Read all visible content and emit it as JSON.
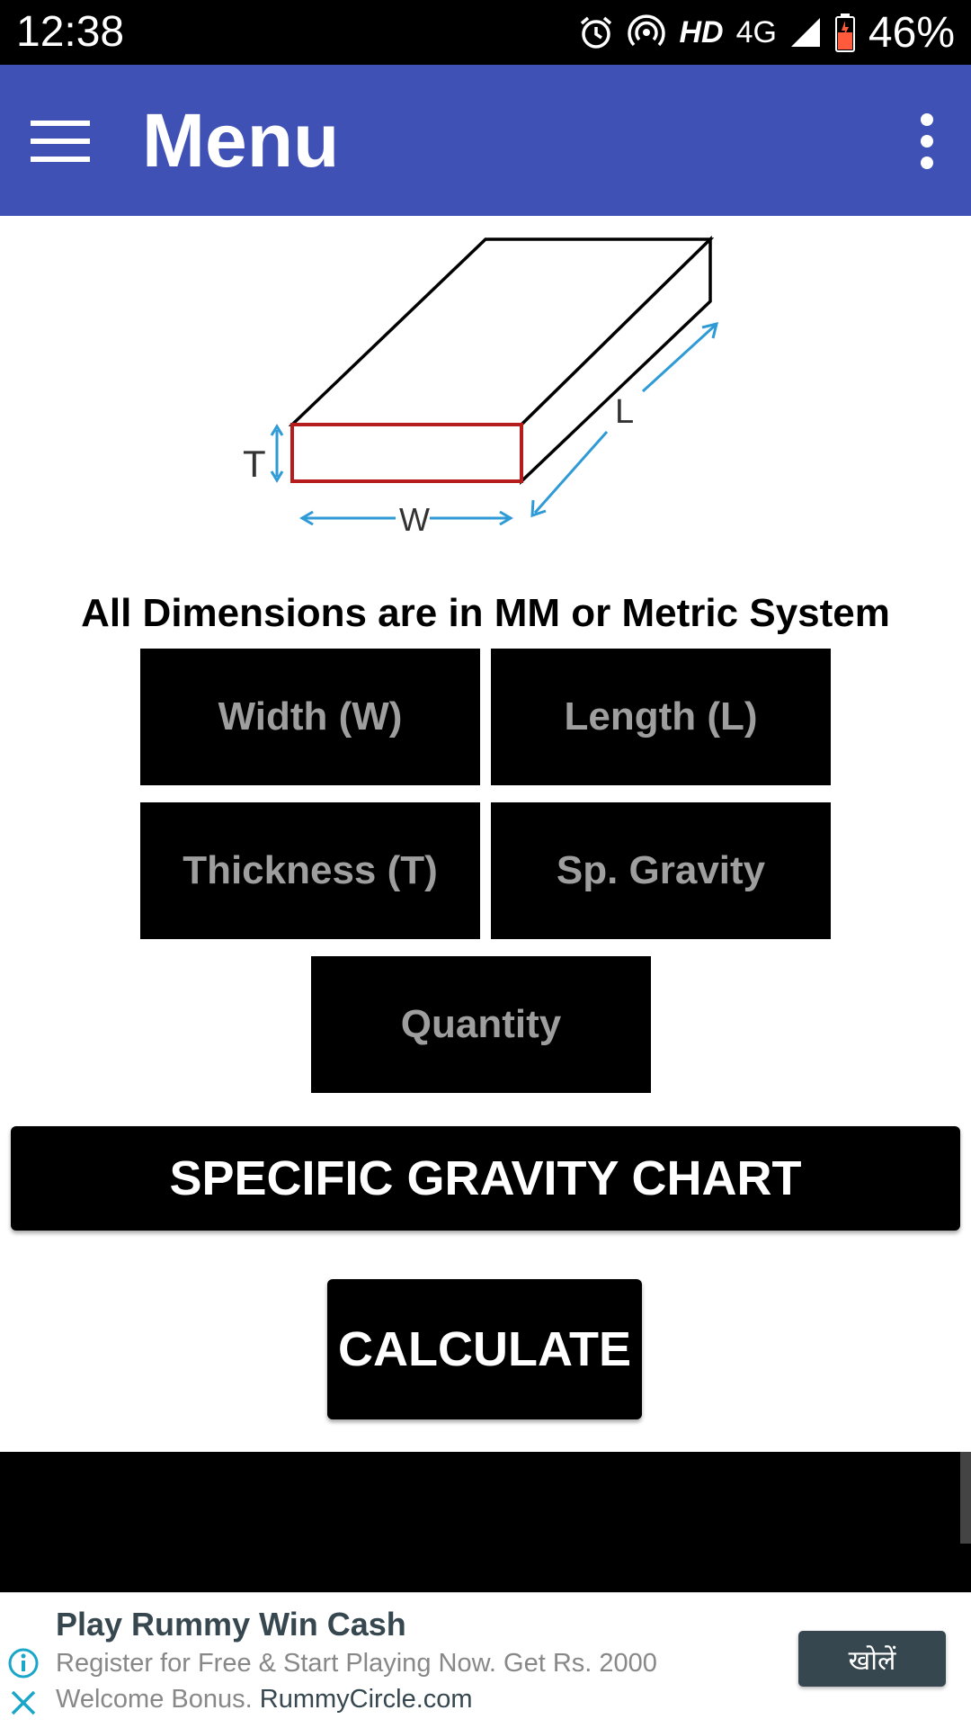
{
  "status_bar": {
    "time": "12:38",
    "hd_label": "HD",
    "network_label": "4G",
    "battery_percent": "46%",
    "icons": [
      "alarm-icon",
      "hotspot-icon",
      "signal-icon",
      "battery-icon"
    ]
  },
  "app_bar": {
    "title": "Menu",
    "icons": [
      "menu-icon",
      "more-vert-icon"
    ],
    "color": "#3f51b5"
  },
  "diagram": {
    "thickness_label": "T",
    "width_label": "W",
    "length_label": "L",
    "arrow_color": "#2e9ad6",
    "front_face_color": "#b71c1c"
  },
  "note": "All Dimensions are in MM or Metric System",
  "inputs": {
    "width_placeholder": "Width (W)",
    "length_placeholder": "Length (L)",
    "thickness_placeholder": "Thickness (T)",
    "gravity_placeholder": "Sp. Gravity",
    "quantity_placeholder": "Quantity"
  },
  "buttons": {
    "chart_label": "SPECIFIC GRAVITY CHART",
    "calculate_label": "CALCULATE"
  },
  "ad": {
    "title": "Play Rummy Win Cash",
    "body": "Register for Free & Start Playing Now. Get Rs. 2000 Welcome Bonus.",
    "url": "RummyCircle.com",
    "cta_label": "खोलें",
    "icons": [
      "info-icon",
      "close-icon"
    ]
  }
}
